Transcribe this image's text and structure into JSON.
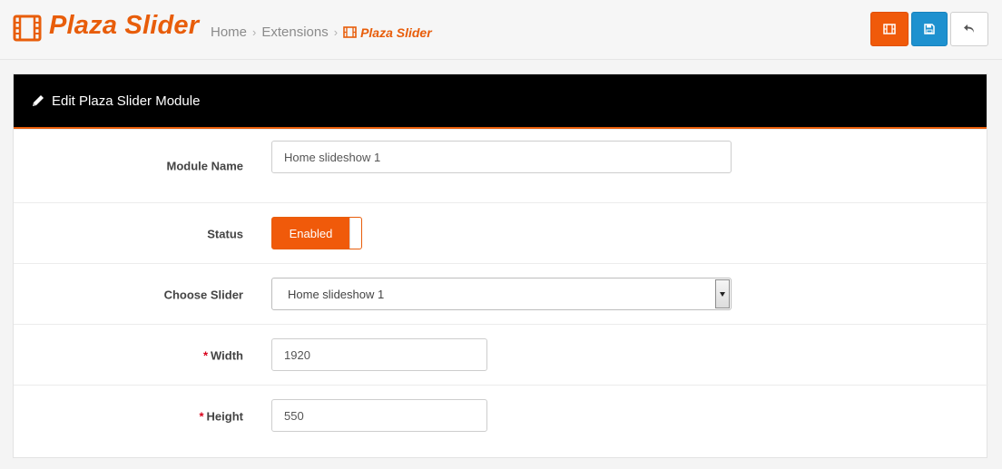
{
  "header": {
    "title": "Plaza Slider",
    "logo_icon": "film-icon",
    "accent_color": "#e85d0a",
    "breadcrumb": [
      "Home",
      "Extensions",
      "Plaza Slider"
    ],
    "breadcrumb_separator": "›"
  },
  "toolbar": {
    "buttons": [
      {
        "name": "slider-button",
        "icon": "film-icon",
        "color": "#f05a0a"
      },
      {
        "name": "save-button",
        "icon": "floppy-disk-icon",
        "color": "#1e91cf"
      },
      {
        "name": "back-button",
        "icon": "reply-arrow-icon",
        "color": "#ffffff"
      }
    ]
  },
  "panel": {
    "icon": "pencil-icon",
    "title": "Edit Plaza Slider Module"
  },
  "form": {
    "module_name": {
      "label": "Module Name",
      "value": "Home slideshow 1"
    },
    "status": {
      "label": "Status",
      "value": "Enabled"
    },
    "choose_slider": {
      "label": "Choose Slider",
      "value": "Home slideshow 1"
    },
    "width": {
      "required_mark": "*",
      "label": "Width",
      "value": "1920"
    },
    "height": {
      "required_mark": "*",
      "label": "Height",
      "value": "550"
    }
  }
}
